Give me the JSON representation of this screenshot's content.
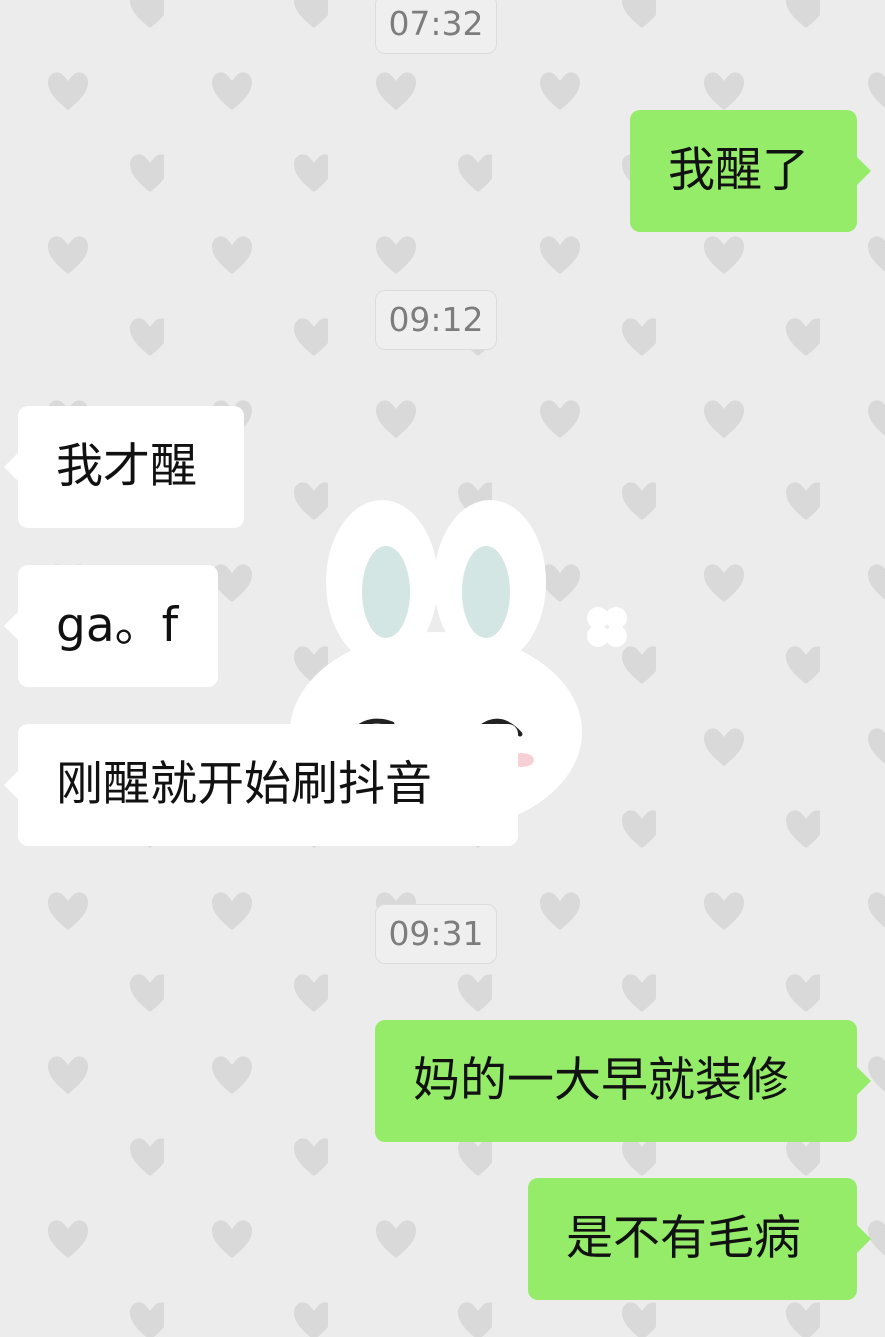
{
  "chat": {
    "background": {
      "pattern": "heart-pattern",
      "sticker": "bunny-sticker",
      "colors": {
        "background": "#ececec",
        "heart": "#d9d9d9",
        "bunny_ear_inner": "#d3e6e4",
        "clover": "#ffffff"
      }
    },
    "messages": [
      {
        "type": "time",
        "text": "07:32"
      },
      {
        "type": "sent",
        "text": "我醒了"
      },
      {
        "type": "time",
        "text": "09:12"
      },
      {
        "type": "received",
        "text": "我才醒"
      },
      {
        "type": "received",
        "text": "ga。f"
      },
      {
        "type": "received",
        "text": "刚醒就开始刷抖音"
      },
      {
        "type": "time",
        "text": "09:31"
      },
      {
        "type": "sent",
        "text": "妈的一大早就装修"
      },
      {
        "type": "sent",
        "text": "是不有毛病"
      }
    ],
    "colors": {
      "sent_bubble": "#95ec69",
      "received_bubble": "#ffffff",
      "time_text": "#7d7d7d"
    }
  }
}
